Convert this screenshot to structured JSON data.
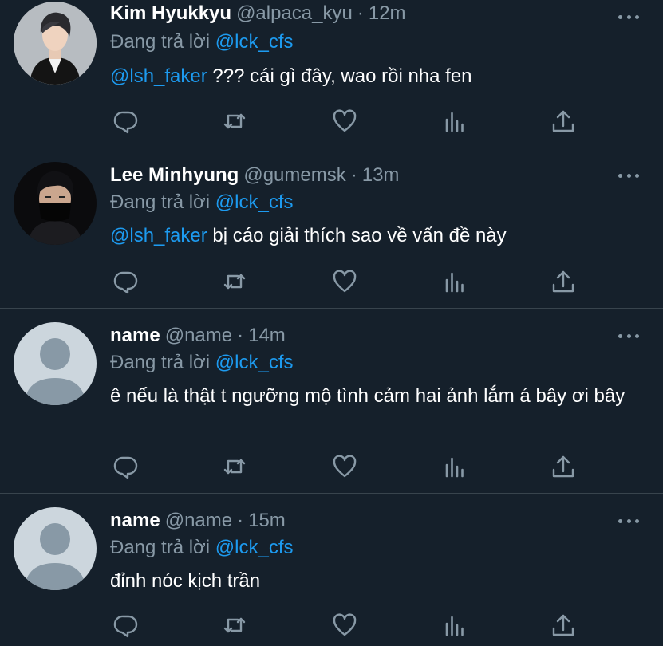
{
  "reply_prefix": "Đang trả lời",
  "colors": {
    "background": "#15202b",
    "secondary_text": "#8899a6",
    "link": "#1d9bf0",
    "divider": "#38444d"
  },
  "icons": [
    "reply-icon",
    "retweet-icon",
    "like-icon",
    "analytics-icon",
    "share-icon",
    "more-icon"
  ],
  "tweets": [
    {
      "display_name": "Kim Hyukkyu",
      "handle": "@alpaca_kyu",
      "separator": "·",
      "time": "12m",
      "replying_to": "@lck_cfs",
      "mention": "@lsh_faker",
      "text": " ??? cái gì đây, wao rồi nha fen",
      "avatar": "photo"
    },
    {
      "display_name": "Lee Minhyung",
      "handle": "@gumemsk",
      "separator": "·",
      "time": "13m",
      "replying_to": "@lck_cfs",
      "mention": "@lsh_faker",
      "text": " bị cáo giải thích sao về vấn đề này",
      "avatar": "photo"
    },
    {
      "display_name": "name",
      "handle": "@name",
      "separator": "·",
      "time": "14m",
      "replying_to": "@lck_cfs",
      "mention": "",
      "text": "ê nếu là thật t ngưỡng mộ tình cảm hai ảnh lắm á bây ơi bây",
      "avatar": "default"
    },
    {
      "display_name": "name",
      "handle": "@name",
      "separator": "·",
      "time": "15m",
      "replying_to": "@lck_cfs",
      "mention": "",
      "text": "đỉnh nóc kịch trần",
      "avatar": "default"
    }
  ]
}
